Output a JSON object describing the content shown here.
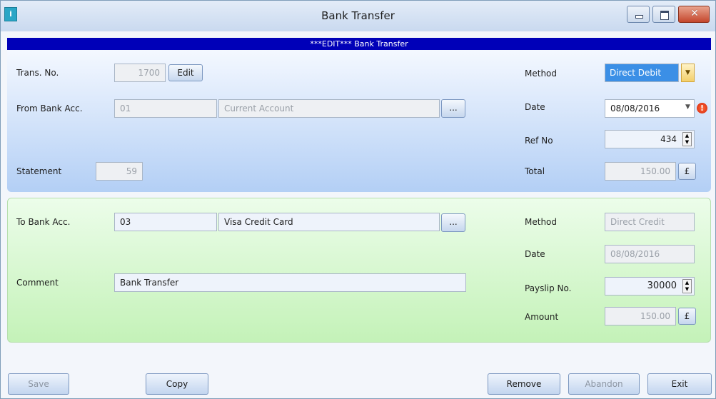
{
  "window": {
    "title": "Bank Transfer",
    "app_icon": "app-icon",
    "close_glyph": "✕"
  },
  "banner": "***EDIT*** Bank Transfer",
  "top": {
    "trans_no": {
      "label": "Trans. No.",
      "value": "1700",
      "edit_button": "Edit"
    },
    "from_bank": {
      "label": "From Bank Acc.",
      "code": "01",
      "name": "Current Account",
      "browse": "..."
    },
    "statement": {
      "label": "Statement",
      "value": "59"
    },
    "method": {
      "label": "Method",
      "value": "Direct Debit"
    },
    "date": {
      "label": "Date",
      "value": "08/08/2016"
    },
    "ref_no": {
      "label": "Ref No",
      "value": "434"
    },
    "total": {
      "label": "Total",
      "value": "150.00",
      "currency": "£"
    }
  },
  "bottom": {
    "to_bank": {
      "label": "To Bank Acc.",
      "code": "03",
      "name": "Visa Credit Card",
      "browse": "..."
    },
    "comment": {
      "label": "Comment",
      "value": "Bank Transfer"
    },
    "method": {
      "label": "Method",
      "value": "Direct Credit"
    },
    "date": {
      "label": "Date",
      "value": "08/08/2016"
    },
    "payslip": {
      "label": "Payslip No.",
      "value": "30000"
    },
    "amount": {
      "label": "Amount",
      "value": "150.00",
      "currency": "£"
    }
  },
  "footer": {
    "save": "Save",
    "copy": "Copy",
    "remove": "Remove",
    "abandon": "Abandon",
    "exit": "Exit"
  },
  "colors": {
    "banner": "#0000b8",
    "top_panel": "#b3cff5",
    "bottom_panel": "#c4f2b8",
    "selected_method": "#3b8fe6"
  }
}
